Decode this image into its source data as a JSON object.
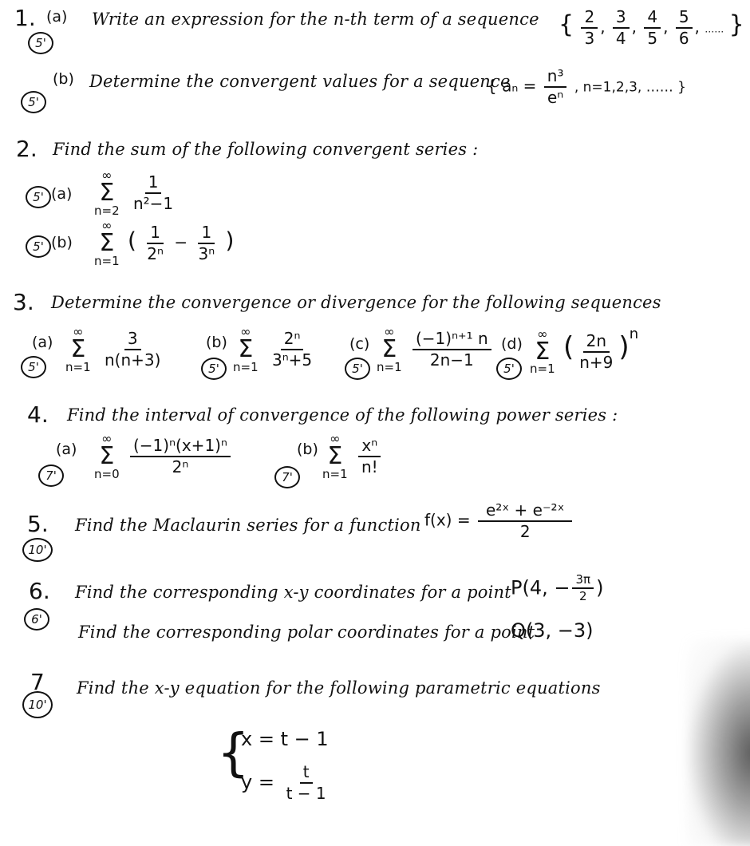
{
  "questions": [
    {
      "number": "1.",
      "parts": [
        {
          "label": "(a)",
          "points": "5'",
          "text": "Write an expression for the n-th term of a sequence",
          "sequence": {
            "open": "{",
            "terms": [
              [
                "2",
                "3"
              ],
              [
                "3",
                "4"
              ],
              [
                "4",
                "5"
              ],
              [
                "5",
                "6"
              ]
            ],
            "tail": "……",
            "close": "}"
          }
        },
        {
          "label": "(b)",
          "points": "5'",
          "text": "Determine the convergent values for a sequence",
          "expr": {
            "lhs": "{ aₙ =",
            "num": "n³",
            "den": "eⁿ",
            "rest": ", n=1,2,3, …… }"
          }
        }
      ]
    },
    {
      "number": "2.",
      "text": "Find the sum of the following convergent series :",
      "parts": [
        {
          "label": "(a)",
          "points": "5'",
          "sum_top": "∞",
          "sum_bot": "n=2",
          "num": "1",
          "den": "n²−1"
        },
        {
          "label": "(b)",
          "points": "5'",
          "sum_top": "∞",
          "sum_bot": "n=1",
          "open": "(",
          "t1_num": "1",
          "t1_den": "2ⁿ",
          "minus": "−",
          "t2_num": "1",
          "t2_den": "3ⁿ",
          "close": ")"
        }
      ]
    },
    {
      "number": "3.",
      "text": "Determine the convergence or divergence for the following sequences",
      "parts": [
        {
          "label": "(a)",
          "points": "5'",
          "sum_top": "∞",
          "sum_bot": "n=1",
          "num": "3",
          "den": "n(n+3)"
        },
        {
          "label": "(b)",
          "points": "5'",
          "sum_top": "∞",
          "sum_bot": "n=1",
          "num": "2ⁿ",
          "den": "3ⁿ+5"
        },
        {
          "label": "(c)",
          "points": "5'",
          "sum_top": "∞",
          "sum_bot": "n=1",
          "num": "(−1)ⁿ⁺¹ n",
          "den": "2n−1"
        },
        {
          "label": "(d)",
          "points": "5'",
          "sum_top": "∞",
          "sum_bot": "n=1",
          "num": "2n",
          "den": "n+9",
          "power": "n"
        }
      ]
    },
    {
      "number": "4.",
      "text": "Find the interval of convergence of the following power series :",
      "parts": [
        {
          "label": "(a)",
          "points": "7'",
          "sum_top": "∞",
          "sum_bot": "n=0",
          "num": "(−1)ⁿ(x+1)ⁿ",
          "den": "2ⁿ"
        },
        {
          "label": "(b)",
          "points": "7'",
          "sum_top": "∞",
          "sum_bot": "n=1",
          "num": "xⁿ",
          "den": "n!"
        }
      ]
    },
    {
      "number": "5.",
      "points": "10'",
      "text": "Find the Maclaurin series for a function",
      "func": "f(x) =",
      "num": "e²ˣ + e⁻²ˣ",
      "den": "2"
    },
    {
      "number": "6.",
      "points": "6'",
      "lines": [
        {
          "text": "Find the corresponding x-y coordinates for a point",
          "point": "P(4, −",
          "frac_num": "3π",
          "frac_den": "2",
          "close": ")"
        },
        {
          "text": "Find the corresponding polar coordinates for a point",
          "point": "Q(3, −3)"
        }
      ]
    },
    {
      "number": "7",
      "points": "10'",
      "text": "Find the x-y equation for the following parametric equations",
      "system": {
        "brace": "{",
        "eq1": "x = t − 1",
        "eq2_lhs": "y =",
        "eq2_num": "t",
        "eq2_den": "t − 1"
      }
    }
  ]
}
